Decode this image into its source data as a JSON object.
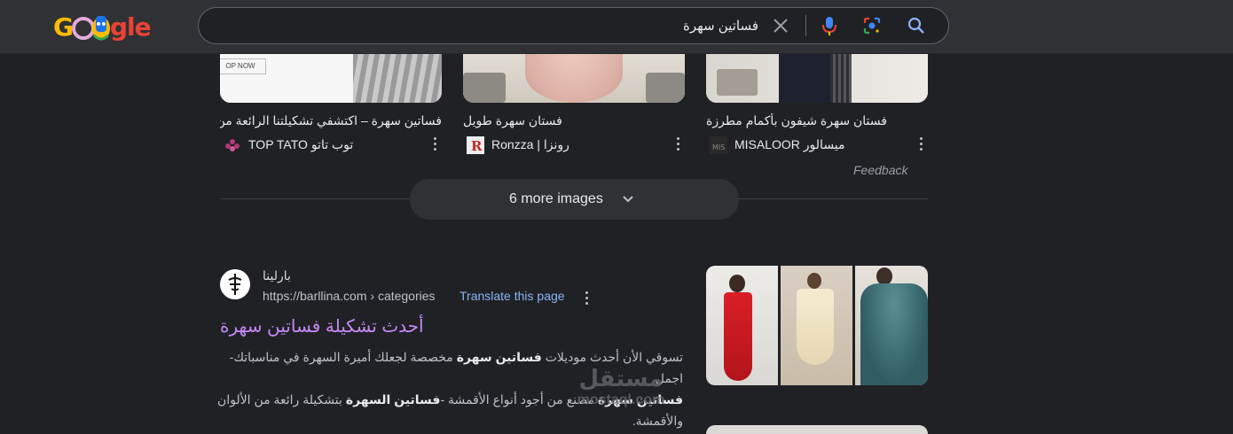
{
  "header": {
    "logo_letters": [
      "G",
      "gle"
    ],
    "search_query": "فساتين سهرة"
  },
  "image_cards": [
    {
      "title": "فساتين سهرة – اكتشفي تشكيلتنا الرائعة من ...",
      "source": "TOP TATO توب تاتو",
      "thumb_caption": "OP NOW"
    },
    {
      "title": "فستان سهرة طويل",
      "source": "Ronzza | رونزا"
    },
    {
      "title": "فستان سهرة شيفون بأكمام مطرزة",
      "source": "MISALOOR ميسالور"
    }
  ],
  "feedback_label": "Feedback",
  "more_images_label": "6 more images",
  "result": {
    "site_name": "بارلينا",
    "url": "https://barllina.com › categories",
    "translate_label": "Translate this page",
    "title": "أحدث تشكيلة فساتين سهرة",
    "snippet_line1_pre": "تسوقي الأن أحدث موديلات ",
    "snippet_line1_bold": "فساتين سهرة",
    "snippet_line1_post": " مخصصة لجعلك أميرة السهرة في مناسباتك-اجمل",
    "snippet_line2_bold1": "فساتين سهرة",
    "snippet_line2_mid": " مصنع من أجود أنواع الأقمشة -",
    "snippet_line2_bold2": "فساتين السهرة",
    "snippet_line2_post": " بتشكيلة رائعة من الألوان والأقمشة."
  },
  "watermark": {
    "arabic": "مستقل",
    "latin": "mostaql.com"
  },
  "colors": {
    "background": "#202124",
    "header": "#303134",
    "visited_link": "#c58af9",
    "link": "#8ab4f8"
  }
}
